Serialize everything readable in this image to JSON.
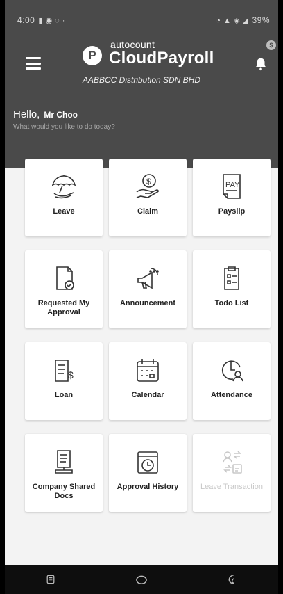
{
  "status_bar": {
    "time": "4:00",
    "battery": "39%"
  },
  "header": {
    "logo_small": "autocount",
    "logo_big": "CloudPayroll",
    "logo_letter": "P",
    "company": "AABBCC Distribution SDN BHD",
    "greeting": "Hello,",
    "user_name": "Mr Choo",
    "prompt": "What would you like to do today?",
    "badge_icon": "dollar-icon"
  },
  "menu": [
    {
      "label": "Leave",
      "icon": "umbrella-icon"
    },
    {
      "label": "Claim",
      "icon": "hand-dollar-icon"
    },
    {
      "label": "Payslip",
      "icon": "payslip-icon"
    },
    {
      "label": "Requested My Approval",
      "icon": "document-check-icon"
    },
    {
      "label": "Announcement",
      "icon": "megaphone-icon"
    },
    {
      "label": "Todo List",
      "icon": "clipboard-icon"
    },
    {
      "label": "Loan",
      "icon": "loan-document-icon"
    },
    {
      "label": "Calendar",
      "icon": "calendar-icon"
    },
    {
      "label": "Attendance",
      "icon": "clock-user-icon"
    },
    {
      "label": "Company Shared Docs",
      "icon": "shared-docs-icon"
    },
    {
      "label": "Approval History",
      "icon": "history-clock-icon"
    },
    {
      "label": "Leave Transaction",
      "icon": "leave-transaction-icon",
      "disabled": true
    }
  ],
  "colors": {
    "header": "#4a4a4a",
    "background": "#f3f3f3",
    "card": "#ffffff",
    "navbar": "#0e0e0e"
  }
}
